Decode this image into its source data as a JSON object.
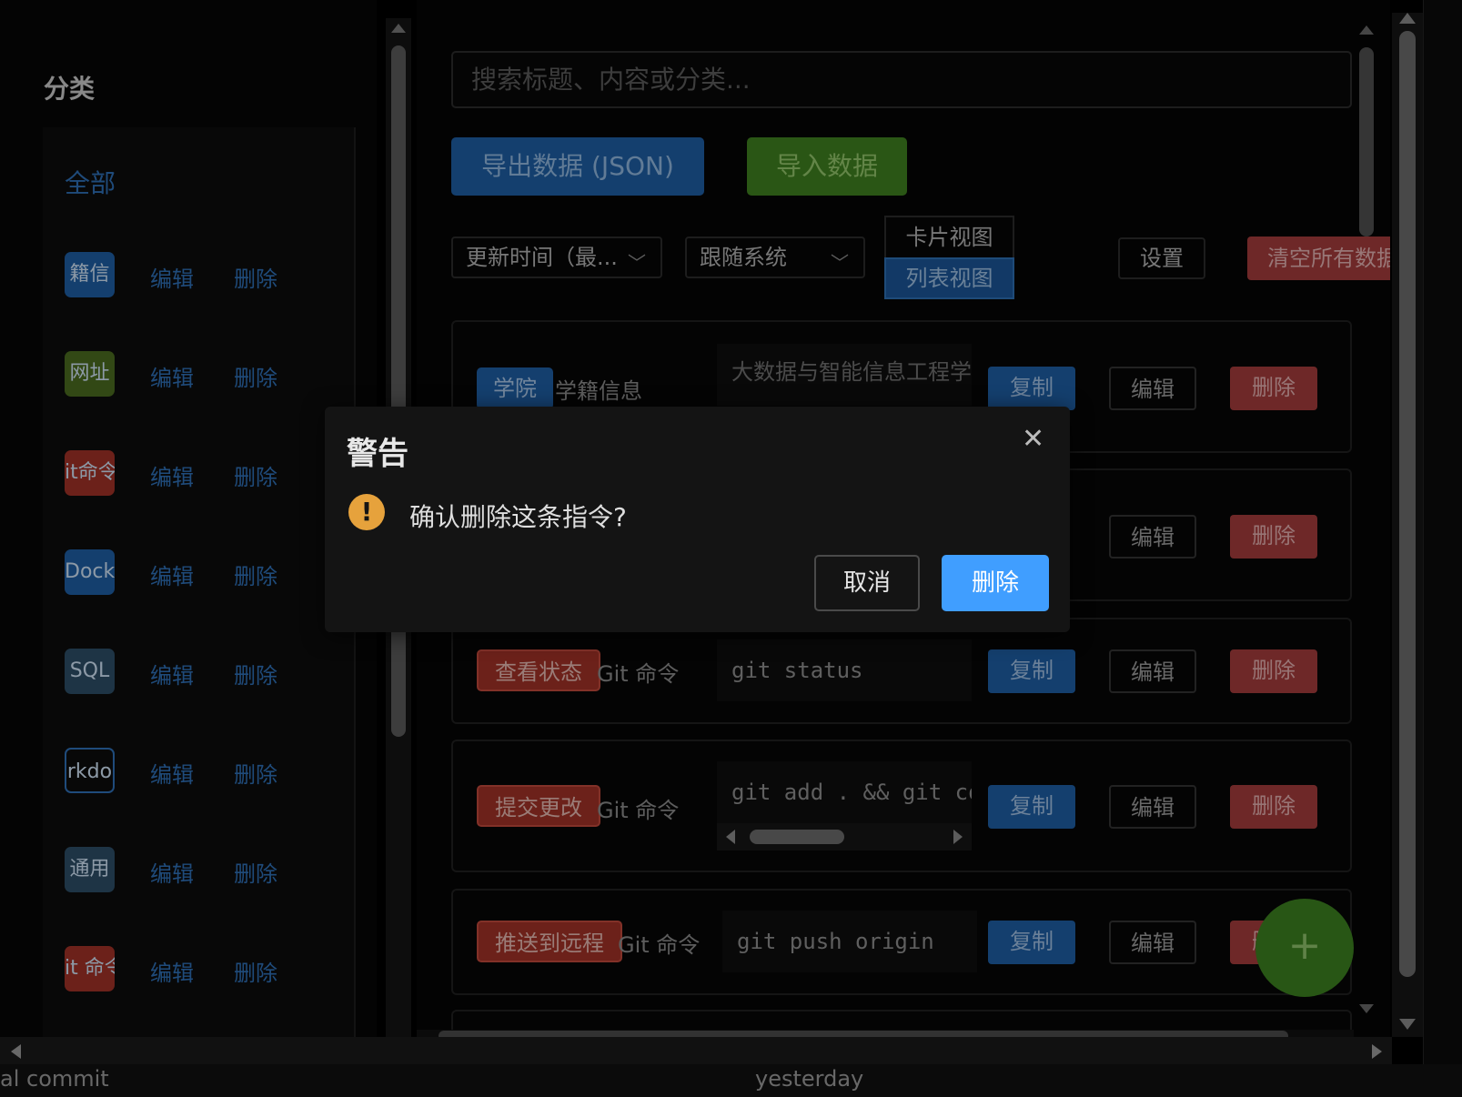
{
  "sidebar": {
    "title": "分类",
    "all_label": "全部",
    "edit_label": "编辑",
    "delete_label": "删除",
    "categories": [
      {
        "label": "籍信",
        "color": "#1e5da2"
      },
      {
        "label": "网址",
        "color": "#4a6b1f"
      },
      {
        "label": "it命令",
        "color": "#9f3227"
      },
      {
        "label": "Docke",
        "color": "#1e5da2"
      },
      {
        "label": "SQL",
        "color": "#2d4d66"
      },
      {
        "label": "rkdo",
        "color": "#0c0c0c"
      },
      {
        "label": "通用",
        "color": "#2d4d66"
      },
      {
        "label": "it 命令",
        "color": "#9f3227"
      }
    ]
  },
  "toolbar": {
    "search_placeholder": "搜索标题、内容或分类...",
    "export_label": "导出数据 (JSON)",
    "import_label": "导入数据",
    "sort_value": "更新时间（最...",
    "theme_value": "跟随系统",
    "view_card_label": "卡片视图",
    "view_list_label": "列表视图",
    "settings_label": "设置",
    "clear_label": "清空所有数据"
  },
  "cards": [
    {
      "tag": "学院",
      "category": "学籍信息",
      "content": "大数据与智能信息工程学院"
    },
    {
      "tag": "",
      "category": "",
      "content": ""
    },
    {
      "tag": "查看状态",
      "category": "Git 命令",
      "content": "git status"
    },
    {
      "tag": "提交更改",
      "category": "Git 命令",
      "content": "git add . && git commit"
    },
    {
      "tag": "推送到远程",
      "category": "Git 命令",
      "content": "git push origin"
    }
  ],
  "card_actions": {
    "copy": "复制",
    "edit": "编辑",
    "delete": "删除"
  },
  "fab_label": "+",
  "bottom_strip": {
    "left": "al commit",
    "mid": "yesterday"
  },
  "dialog": {
    "title": "警告",
    "message": "确认删除这条指令?",
    "cancel_label": "取消",
    "confirm_label": "删除",
    "close_glyph": "✕",
    "warn_glyph": "!"
  },
  "colors": {
    "primary": "#1e5da2",
    "success": "#3f7f1f",
    "danger": "#a23b3b",
    "dialog_confirm": "#409eff",
    "warning": "#e6a23c"
  }
}
